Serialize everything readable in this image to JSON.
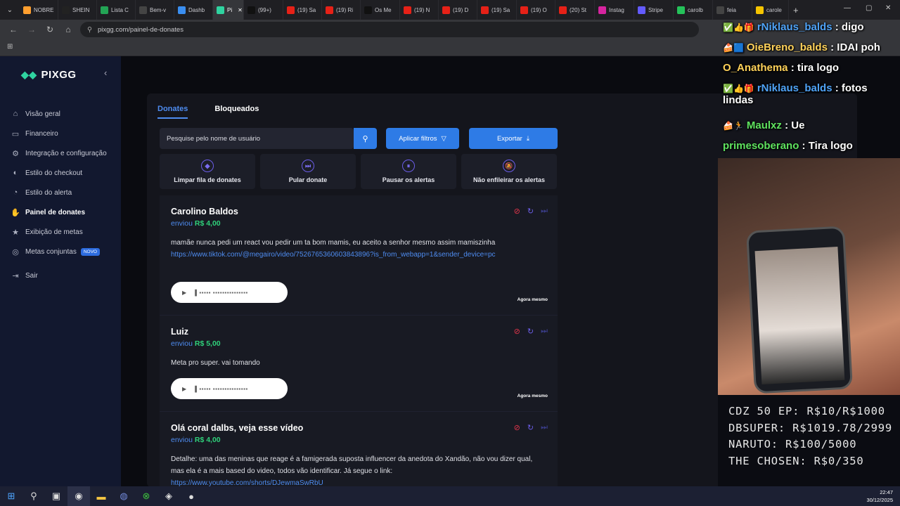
{
  "browser": {
    "tabs": [
      {
        "label": "NOBRE",
        "color": "#ff9f2f"
      },
      {
        "label": "SHEIN",
        "color": "#222"
      },
      {
        "label": "Lista C",
        "color": "#23a455"
      },
      {
        "label": "Bem-v",
        "color": "#444"
      },
      {
        "label": "Dashb",
        "color": "#3a8ef0"
      },
      {
        "label": "Pi",
        "color": "#2fd3a0",
        "active": true
      },
      {
        "label": "(99+)",
        "color": "#111"
      },
      {
        "label": "(19) Sa",
        "color": "#e62117"
      },
      {
        "label": "(19) Ri",
        "color": "#e62117"
      },
      {
        "label": "Os Me",
        "color": "#111"
      },
      {
        "label": "(19) N",
        "color": "#e62117"
      },
      {
        "label": "(19) D",
        "color": "#e62117"
      },
      {
        "label": "(19) Sa",
        "color": "#e62117"
      },
      {
        "label": "(19) O",
        "color": "#e62117"
      },
      {
        "label": "(20) St",
        "color": "#e62117"
      },
      {
        "label": "Instag",
        "color": "#d6249f"
      },
      {
        "label": "Stripe",
        "color": "#635bff"
      },
      {
        "label": "carolb",
        "color": "#25c25a"
      },
      {
        "label": "feia",
        "color": "#444"
      },
      {
        "label": "carole",
        "color": "#f5c400"
      }
    ],
    "url": "pixgg.com/painel-de-donates"
  },
  "sidebar": {
    "brand": "PIXGG",
    "items": [
      {
        "label": "Visão geral",
        "icon": "home-icon",
        "glyph": "⌂"
      },
      {
        "label": "Financeiro",
        "icon": "wallet-icon",
        "glyph": "▭"
      },
      {
        "label": "Integração e configuração",
        "icon": "plug-icon",
        "glyph": "⚙"
      },
      {
        "label": "Estilo do checkout",
        "icon": "palette-icon",
        "glyph": "◐"
      },
      {
        "label": "Estilo do alerta",
        "icon": "bell-icon",
        "glyph": "◔"
      },
      {
        "label": "Painel de donates",
        "icon": "donate-icon",
        "glyph": "✋",
        "active": true
      },
      {
        "label": "Exibição de metas",
        "icon": "star-icon",
        "glyph": "★"
      },
      {
        "label": "Metas conjuntas",
        "icon": "target-icon",
        "glyph": "◎",
        "badge": "NOVO"
      },
      {
        "label": "Sair",
        "icon": "logout-icon",
        "glyph": "⇥"
      }
    ]
  },
  "panel": {
    "tabs": [
      "Donates",
      "Bloqueados"
    ],
    "search_placeholder": "Pesquise pelo nome de usuário",
    "filter_label": "Aplicar filtros",
    "export_label": "Exportar",
    "actions": [
      {
        "label": "Limpar fila de donates",
        "glyph": "◆"
      },
      {
        "label": "Pular donate",
        "glyph": "⏭"
      },
      {
        "label": "Pausar os alertas",
        "glyph": "⏸"
      },
      {
        "label": "Não enfileirar os alertas",
        "glyph": "🔕"
      }
    ],
    "sent_word": "enviou"
  },
  "donations": [
    {
      "name": "Carolino Baldos",
      "amount": "R$ 4,00",
      "message": "mamãe nunca pedi um react vou pedir um ta bom mamis, eu aceito a senhor mesmo assim mamiszinha",
      "link": "https://www.tiktok.com/@megairo/video/7526765360603843896?is_from_webapp=1&sender_device=pc",
      "time": "Agora mesmo"
    },
    {
      "name": "Luiz",
      "amount": "R$ 5,00",
      "message": "Meta pro super. vai tomando",
      "link": "",
      "time": "Agora mesmo"
    },
    {
      "name": "Olá coral dalbs, veja esse vídeo",
      "amount": "R$ 4,00",
      "message": "Detalhe: uma das meninas que reage é a famigerada suposta influencer da anedota do Xandão, não vou dizer qual, mas ela é a mais based do video, todos vão identificar. Já segue o link:",
      "link": "https://www.youtube.com/shorts/DJewmaSwRbU",
      "time": ""
    }
  ],
  "chat": [
    {
      "user": "rNiklaus_balds",
      "text": "digo",
      "color": "cu",
      "badges": "✅👍🎁"
    },
    {
      "user": "OieBreno_balds",
      "text": "IDAI poh",
      "color": "cg",
      "badges": "🍰🟦"
    },
    {
      "user": "O_Anathema",
      "text": "tira logo",
      "color": "cg",
      "badges": ""
    },
    {
      "user": "rNiklaus_balds",
      "text": "fotos",
      "text2": "lindas",
      "color": "cu",
      "badges": "✅👍🎁"
    },
    {
      "user": "Maulxz",
      "text": "Ue",
      "color": "cgr",
      "badges": "🍰🏃"
    },
    {
      "user": "primesoberano",
      "text": "Tira logo",
      "color": "cgr",
      "badges": ""
    }
  ],
  "goals": [
    "CDZ 50 EP: R$10/R$1000",
    "DBSUPER: R$1019.78/2999",
    "NARUTO: R$100/5000",
    "THE CHOSEN: R$0/350"
  ],
  "taskbar": {
    "time": "22:47",
    "date": "30/12/2025"
  }
}
